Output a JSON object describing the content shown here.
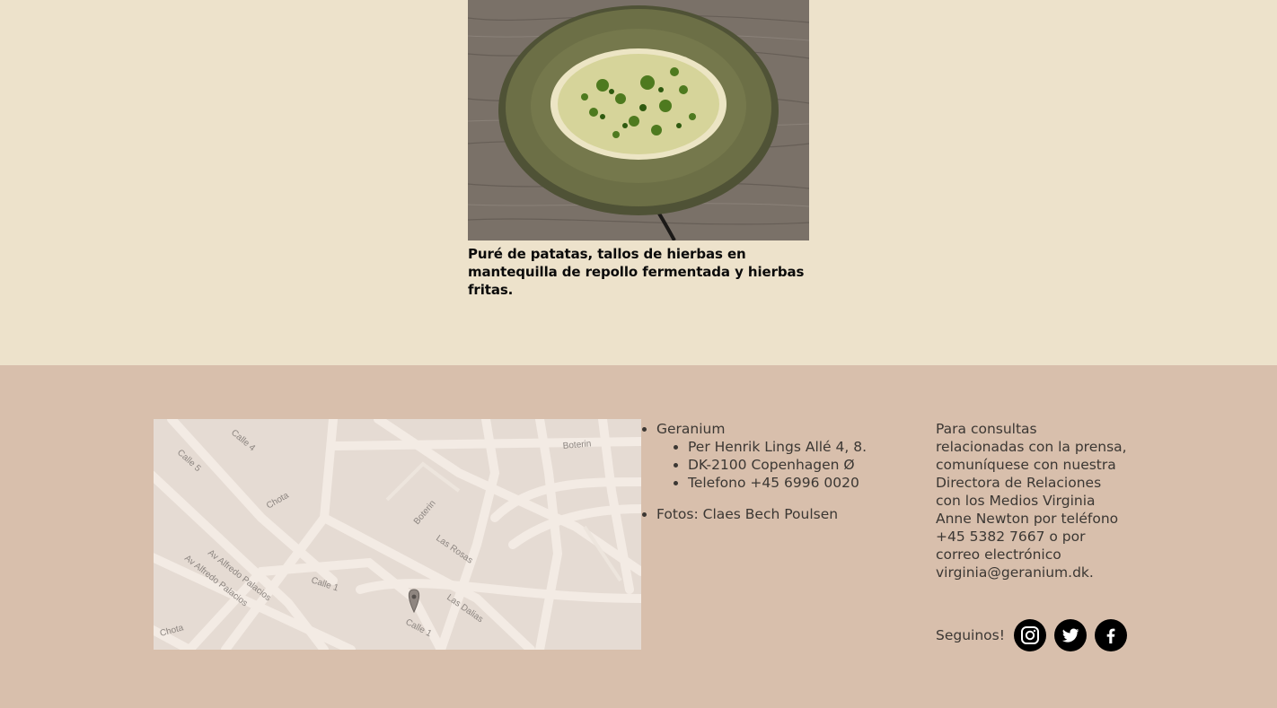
{
  "dish": {
    "image_alt": "Plato de puré de patatas con hierbas",
    "caption": "Puré de patatas, tallos de hierbas en mantequilla de repollo fermentada y hierbas fritas."
  },
  "map": {
    "street_labels": [
      "Calle 4",
      "Calle 5",
      "Chota",
      "Boterin",
      "Boterin",
      "Las Rosas",
      "Calle 1",
      "Av Alfredo Palacios",
      "Av Alfredo Palacios",
      "Las Dalias",
      "Calle 1",
      "Chota"
    ]
  },
  "info": {
    "name": "Geranium",
    "address_line": "Per Henrik Lings Allé 4, 8.",
    "city_line": "DK-2100 Copenhagen Ø",
    "phone_line": "Telefono +45 6996 0020",
    "photos_credit": "Fotos: Claes Bech Poulsen"
  },
  "press": {
    "text": "Para consultas relacionadas con la prensa, comuníquese con nuestra Directora de Relaciones con los Medios Virginia Anne Newton por teléfono +45 5382 7667 o por correo electrónico virginia@geranium.dk."
  },
  "social": {
    "label": "Seguinos!",
    "icons": [
      "instagram-icon",
      "twitter-icon",
      "facebook-icon"
    ]
  },
  "colors": {
    "top_background": "#ede2cb",
    "footer_background": "#d8bfac",
    "text": "#3b3733"
  }
}
